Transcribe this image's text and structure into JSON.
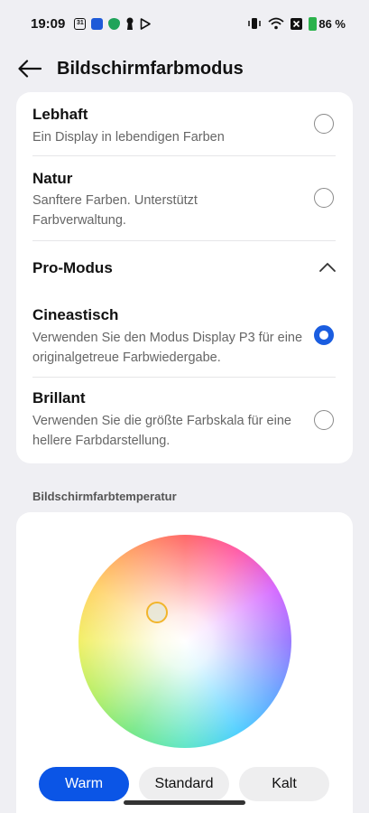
{
  "status": {
    "time": "19:09",
    "left_icons": [
      "calendar-31-icon",
      "blue-app-icon",
      "shield-app-icon",
      "keyhole-icon",
      "play-store-icon"
    ],
    "calendar_day": "31",
    "right_icons": [
      "vibrate-icon",
      "wifi-icon",
      "x-icon",
      "battery-charging-icon"
    ],
    "battery": "86 %",
    "colors": {
      "battery": "#2bb24c",
      "app_blue": "#1e5ad8",
      "app_green": "#1fa35a"
    }
  },
  "header": {
    "title": "Bildschirmfarbmodus"
  },
  "modes": {
    "lebhaft": {
      "title": "Lebhaft",
      "desc": "Ein Display in lebendigen Farben",
      "selected": false
    },
    "natur": {
      "title": "Natur",
      "desc": "Sanftere Farben. Unterstützt Farbverwaltung.",
      "selected": false
    },
    "pro": {
      "title": "Pro-Modus",
      "expanded": true
    },
    "cineastisch": {
      "title": "Cineastisch",
      "desc": "Verwenden Sie den Modus Display P3 für eine originalgetreue Farbwiedergabe.",
      "selected": true
    },
    "brillant": {
      "title": "Brillant",
      "desc": "Verwenden Sie die größte Farbskala für eine hellere Farbdarstellung.",
      "selected": false
    }
  },
  "temperature": {
    "label": "Bildschirmfarbtemperatur",
    "buttons": {
      "warm": "Warm",
      "standard": "Standard",
      "kalt": "Kalt"
    },
    "active": "Warm",
    "accent": "#0b55e6"
  }
}
